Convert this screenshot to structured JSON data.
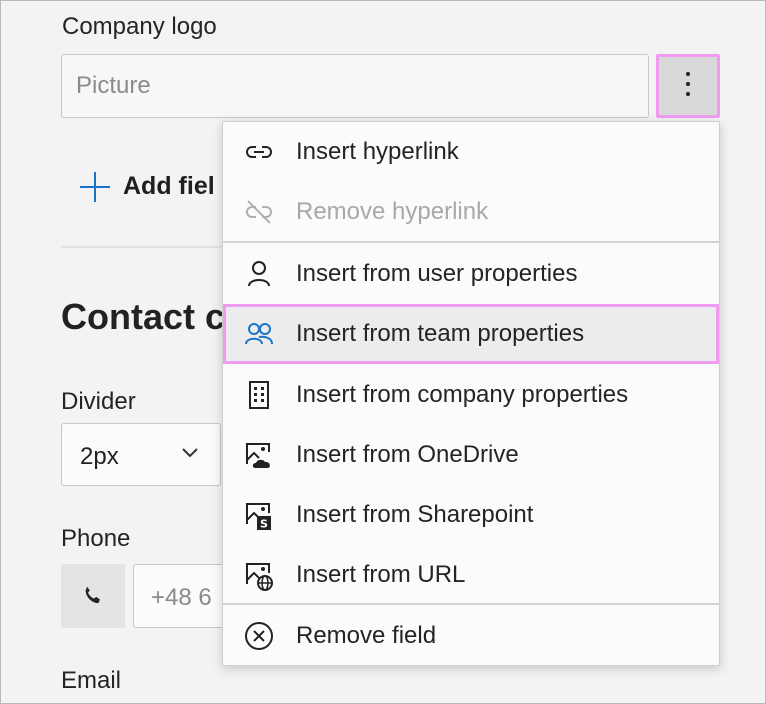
{
  "logo_field": {
    "label": "Company logo",
    "placeholder": "Picture"
  },
  "more_options_button": {
    "icon": "more-vertical-icon"
  },
  "add_field": {
    "label": "Add fiel"
  },
  "section": {
    "title": "Contact c"
  },
  "divider": {
    "label": "Divider",
    "value": "2px"
  },
  "phone": {
    "label": "Phone",
    "placeholder": "+48 6",
    "icon": "phone-icon"
  },
  "email": {
    "label": "Email"
  },
  "context_menu": {
    "items": [
      {
        "label": "Insert hyperlink",
        "icon": "link-icon",
        "enabled": true
      },
      {
        "label": "Remove hyperlink",
        "icon": "link-remove-icon",
        "enabled": false
      },
      {
        "label": "Insert from user properties",
        "icon": "person-icon",
        "enabled": true
      },
      {
        "label": "Insert from team properties",
        "icon": "people-team-icon",
        "enabled": true,
        "highlighted": true
      },
      {
        "label": "Insert from company properties",
        "icon": "building-icon",
        "enabled": true
      },
      {
        "label": "Insert from OneDrive",
        "icon": "image-onedrive-icon",
        "enabled": true
      },
      {
        "label": "Insert from Sharepoint",
        "icon": "image-sharepoint-icon",
        "enabled": true
      },
      {
        "label": "Insert from URL",
        "icon": "image-globe-icon",
        "enabled": true
      },
      {
        "label": "Remove field",
        "icon": "dismiss-circle-icon",
        "enabled": true
      }
    ]
  },
  "colors": {
    "accent": "#1a74c9",
    "highlight_border": "#ef9cf0",
    "disabled_text": "#a8a8a8"
  }
}
